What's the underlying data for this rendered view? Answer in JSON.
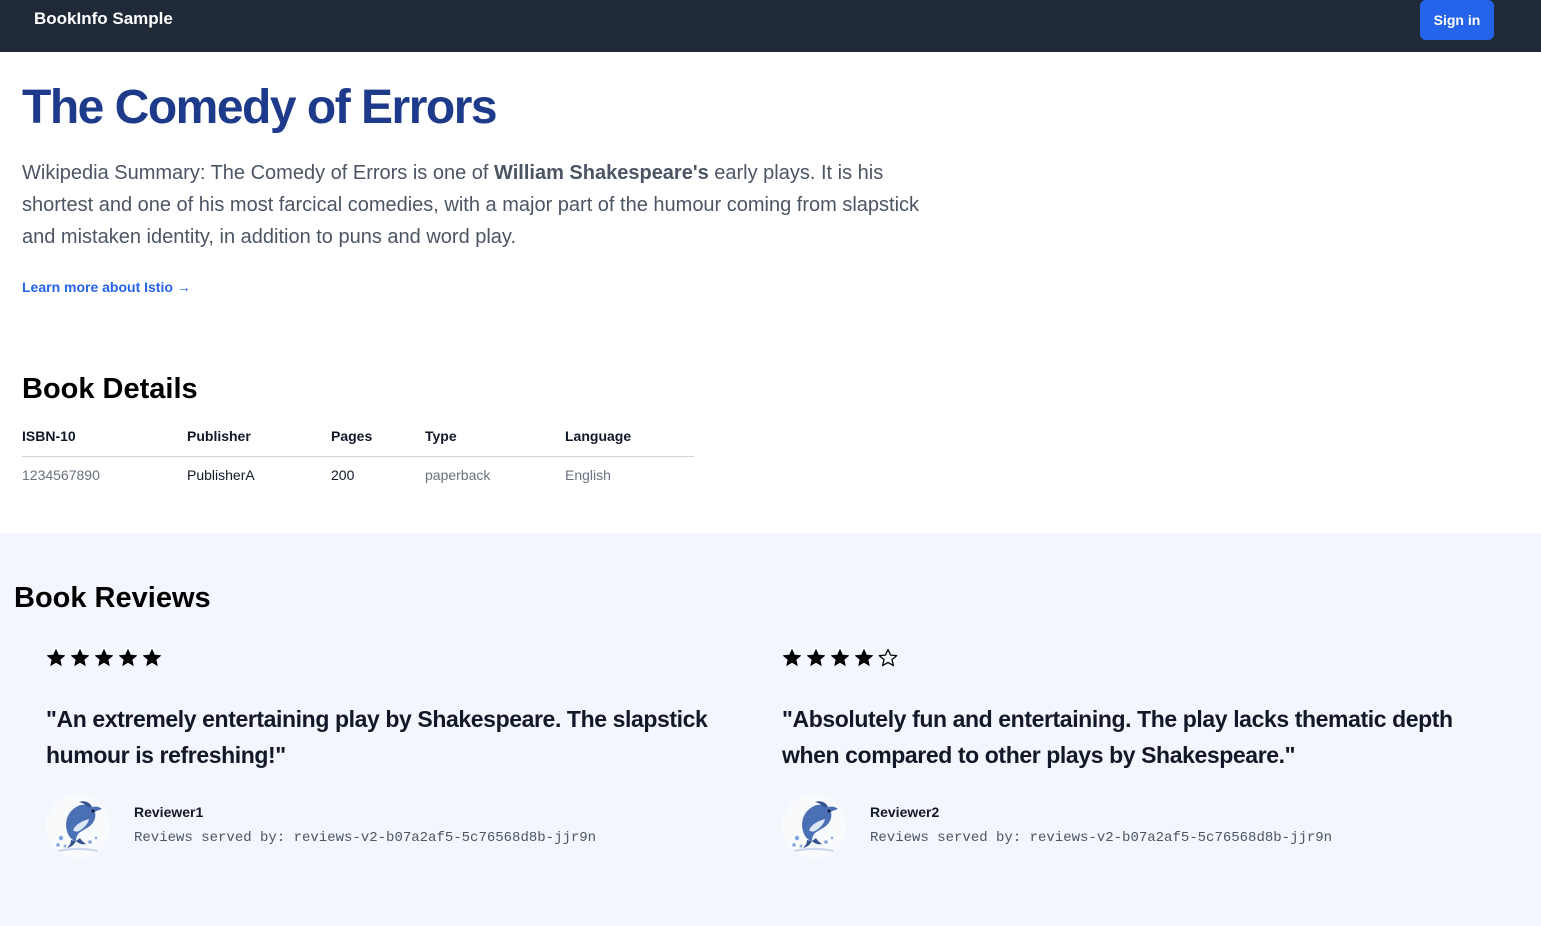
{
  "header": {
    "brand": "BookInfo Sample",
    "signin_label": "Sign in"
  },
  "book": {
    "title": "The Comedy of Errors",
    "summary_prefix": "Wikipedia Summary: The Comedy of Errors is one of ",
    "summary_bold": "William Shakespeare's",
    "summary_suffix": " early plays. It is his shortest and one of his most farcical comedies, with a major part of the humour coming from slapstick and mistaken identity, in addition to puns and word play.",
    "learn_more": "Learn more about Istio →"
  },
  "details": {
    "title": "Book Details",
    "headers": [
      "ISBN-10",
      "Publisher",
      "Pages",
      "Type",
      "Language"
    ],
    "row": [
      "1234567890",
      "PublisherA",
      "200",
      "paperback",
      "English"
    ]
  },
  "reviews": {
    "title": "Book Reviews",
    "items": [
      {
        "rating": 5,
        "max_rating": 5,
        "text": "\"An extremely entertaining play by Shakespeare. The slapstick humour is refreshing!\"",
        "reviewer": "Reviewer1",
        "served_by": "Reviews served by: reviews-v2-b07a2af5-5c76568d8b-jjr9n",
        "avatar_icon": "dolphin-icon"
      },
      {
        "rating": 4,
        "max_rating": 5,
        "text": "\"Absolutely fun and entertaining. The play lacks thematic depth when compared to other plays by Shakespeare.\"",
        "reviewer": "Reviewer2",
        "served_by": "Reviews served by: reviews-v2-b07a2af5-5c76568d8b-jjr9n",
        "avatar_icon": "dolphin-icon"
      }
    ]
  },
  "colors": {
    "header_bg": "#1f2937",
    "accent": "#2563eb",
    "title": "#1e3a8a",
    "reviews_bg": "#f3f6fd"
  }
}
